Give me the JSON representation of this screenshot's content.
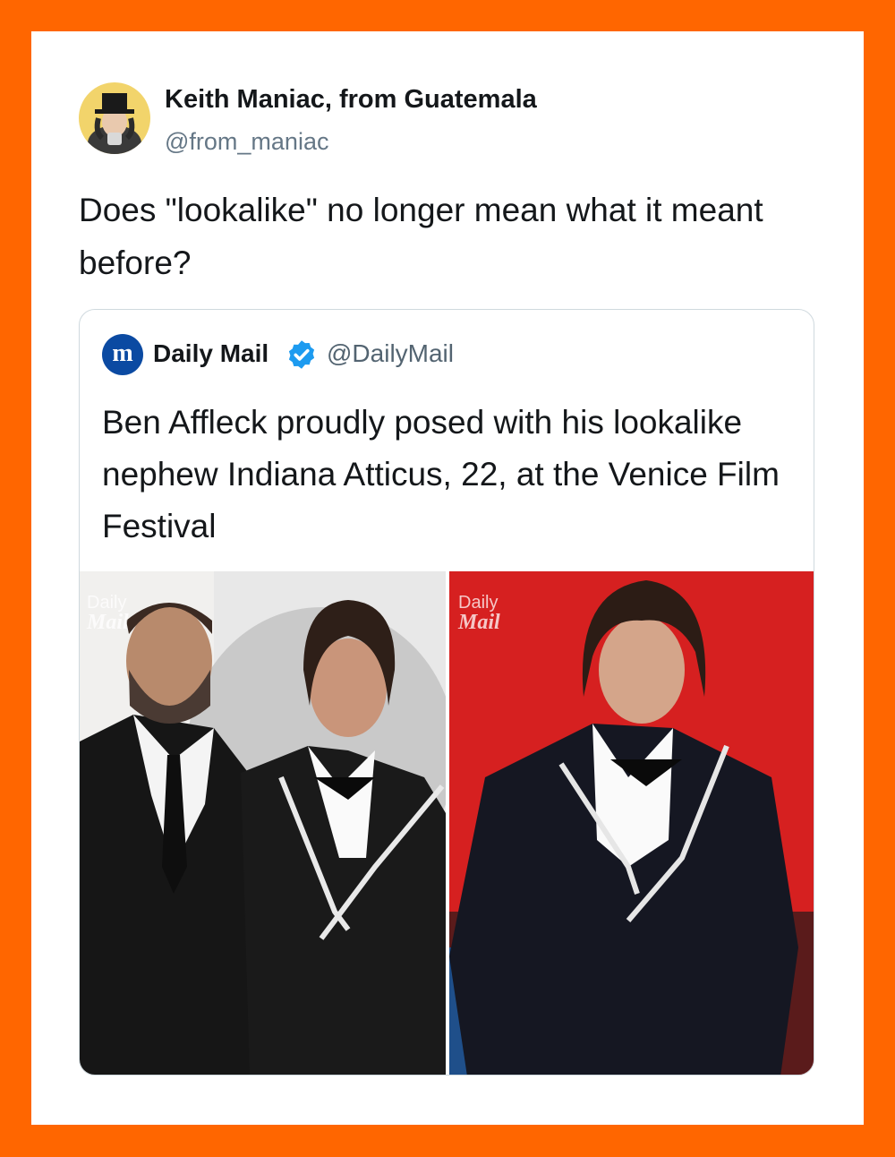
{
  "tweet": {
    "author_name": "Keith Maniac, from Guatemala",
    "author_handle": "@from_maniac",
    "text": "Does \"lookalike\" no longer mean what it meant before?",
    "avatar": "user-avatar-top-hat"
  },
  "quoted_tweet": {
    "logo_letter": "m",
    "author_name": "Daily Mail",
    "verified": true,
    "author_handle": "@DailyMail",
    "text": "Ben Affleck proudly posed with his lookalike nephew Indiana Atticus, 22, at the Venice Film Festival",
    "images": [
      {
        "alt": "photo-two-men-in-suits",
        "watermark_line1": "Daily",
        "watermark_line2": "Mail"
      },
      {
        "alt": "photo-young-man-in-suit",
        "watermark_line1": "Daily",
        "watermark_line2": "Mail"
      }
    ]
  },
  "colors": {
    "frame": "#ff6600",
    "card": "#ffffff",
    "verified": "#1d9bf0",
    "logo": "#0b4aa2",
    "photo_right_bg": "#d62020"
  }
}
